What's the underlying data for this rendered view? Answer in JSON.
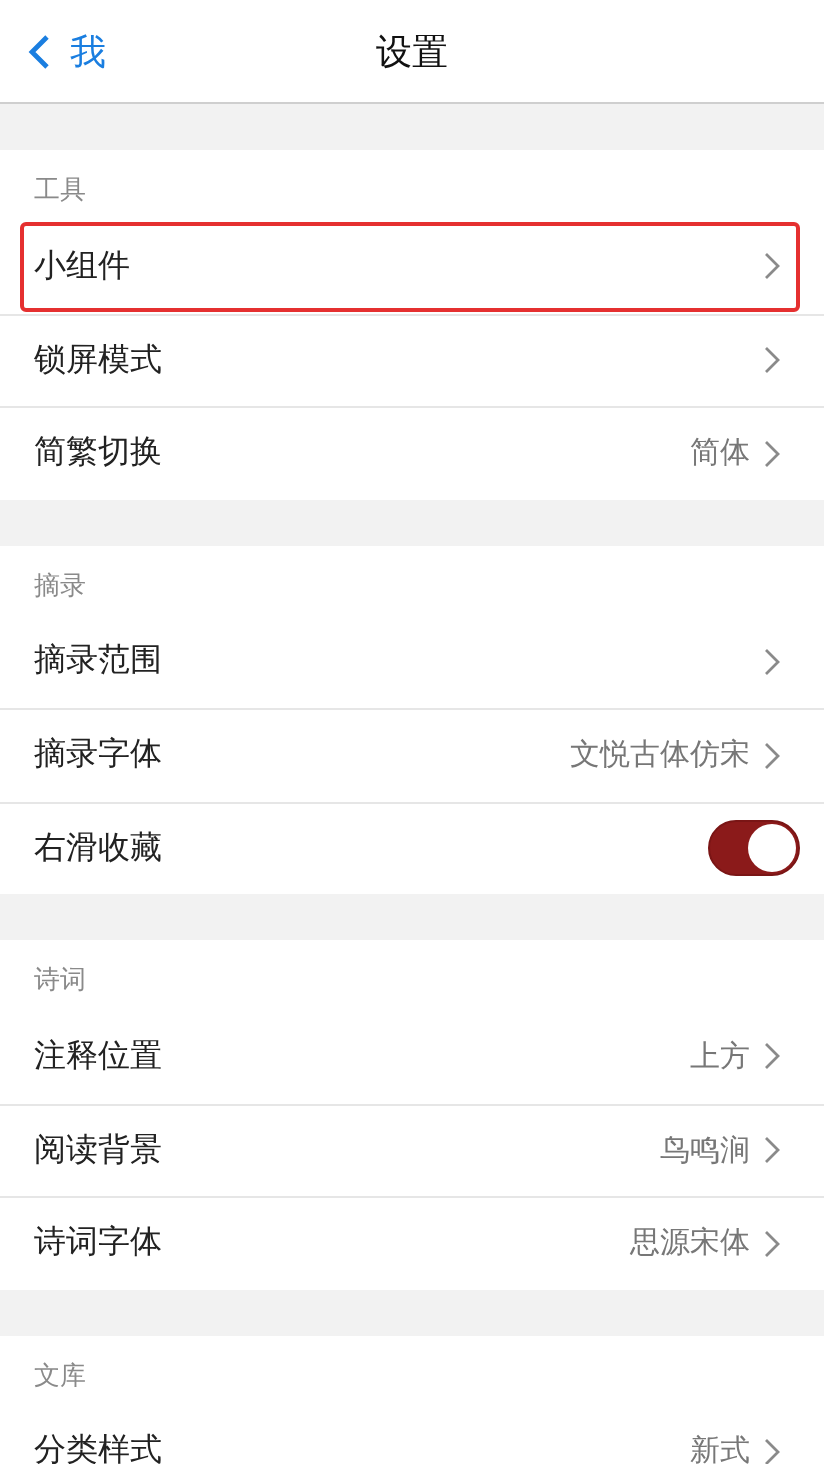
{
  "nav": {
    "back_label": "我",
    "title": "设置"
  },
  "sections": [
    {
      "header": "工具",
      "items": [
        {
          "kind": "link",
          "label": "小组件",
          "highlighted": true
        },
        {
          "kind": "link",
          "label": "锁屏模式",
          "highlighted": false
        },
        {
          "kind": "link",
          "label": "简繁切换",
          "value": "简体",
          "highlighted": false
        }
      ]
    },
    {
      "header": "摘录",
      "items": [
        {
          "kind": "link",
          "label": "摘录范围",
          "highlighted": false
        },
        {
          "kind": "link",
          "label": "摘录字体",
          "value": "文悦古体仿宋",
          "highlighted": false
        },
        {
          "kind": "toggle",
          "label": "右滑收藏",
          "on": true,
          "highlighted": false
        }
      ]
    },
    {
      "header": "诗词",
      "items": [
        {
          "kind": "link",
          "label": "注释位置",
          "value": "上方",
          "highlighted": false
        },
        {
          "kind": "link",
          "label": "阅读背景",
          "value": "鸟鸣涧",
          "highlighted": false
        },
        {
          "kind": "link",
          "label": "诗词字体",
          "value": "思源宋体",
          "highlighted": false
        }
      ]
    },
    {
      "header": "文库",
      "items": [
        {
          "kind": "link",
          "label": "分类样式",
          "value": "新式",
          "highlighted": false
        }
      ]
    }
  ]
}
